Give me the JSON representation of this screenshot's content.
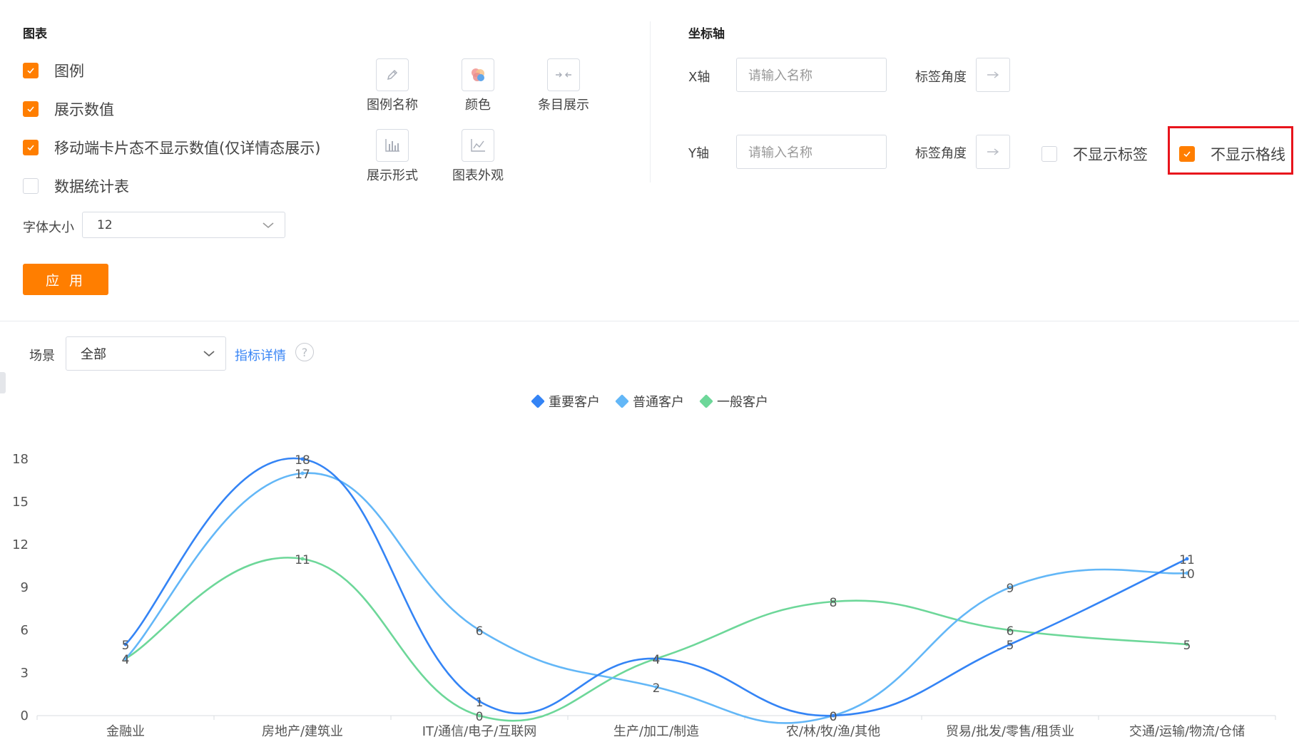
{
  "chart_settings": {
    "title": "图表",
    "options": [
      {
        "label": "图例",
        "checked": true
      },
      {
        "label": "展示数值",
        "checked": true
      },
      {
        "label": "移动端卡片态不显示数值(仅详情态展示)",
        "checked": true
      },
      {
        "label": "数据统计表",
        "checked": false
      }
    ],
    "font_size_label": "字体大小",
    "font_size_value": "12",
    "apply_label": "应 用",
    "tools": [
      {
        "label": "图例名称",
        "icon": "pencil-icon"
      },
      {
        "label": "颜色",
        "icon": "color-palette-icon"
      },
      {
        "label": "条目展示",
        "icon": "collapse-arrows-icon"
      },
      {
        "label": "展示形式",
        "icon": "bar-chart-icon"
      },
      {
        "label": "图表外观",
        "icon": "line-chart-icon"
      }
    ]
  },
  "axis_settings": {
    "title": "坐标轴",
    "x_label": "X轴",
    "y_label": "Y轴",
    "name_placeholder": "请输入名称",
    "tag_angle_label": "标签角度",
    "hide_labels": {
      "label": "不显示标签",
      "checked": false
    },
    "hide_gridlines": {
      "label": "不显示格线",
      "checked": true
    }
  },
  "scene": {
    "label": "场景",
    "value": "全部",
    "metric_link": "指标详情",
    "help_icon": "?"
  },
  "colors": {
    "accent": "#ff7e00",
    "link": "#3a86f5",
    "highlight": "#e8141c",
    "series": [
      "#3484f5",
      "#63b7f7",
      "#6dd799"
    ]
  },
  "chart_data": {
    "type": "line",
    "smooth": true,
    "categories": [
      "金融业",
      "房地产/建筑业",
      "IT/通信/电子/互联网",
      "生产/加工/制造",
      "农/林/牧/渔/其他",
      "贸易/批发/零售/租赁业",
      "交通/运输/物流/仓储"
    ],
    "series": [
      {
        "name": "重要客户",
        "values": [
          5,
          18,
          1,
          4,
          0,
          5,
          11
        ]
      },
      {
        "name": "普通客户",
        "values": [
          4,
          17,
          6,
          2,
          0,
          9,
          10
        ]
      },
      {
        "name": "一般客户",
        "values": [
          4,
          11,
          0,
          4,
          8,
          6,
          5
        ]
      }
    ],
    "y_ticks": [
      "0",
      "3",
      "6",
      "9",
      "12",
      "15",
      "18"
    ],
    "ylim": [
      0,
      18
    ],
    "grid": false,
    "legend_position": "top-center",
    "show_values": true
  }
}
